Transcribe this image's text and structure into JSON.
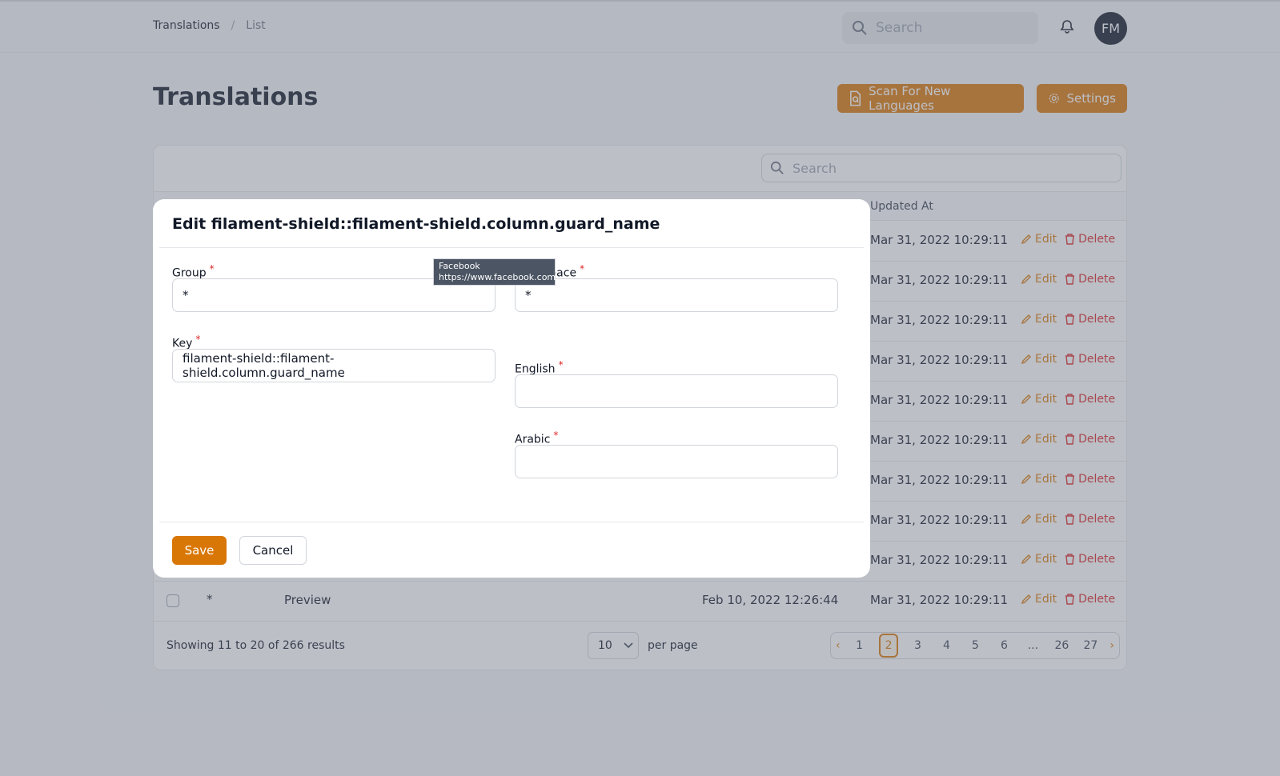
{
  "breadcrumb": {
    "root": "Translations",
    "current": "List"
  },
  "topbar": {
    "search_placeholder": "Search",
    "avatar_initials": "FM"
  },
  "page": {
    "title": "Translations"
  },
  "actions": {
    "scan_label": "Scan For New Languages",
    "settings_label": "Settings"
  },
  "table": {
    "search_placeholder": "Search",
    "header_updated_at": "Updated At",
    "rows": [
      {
        "updated_at": "Mar 31, 2022 10:29:11"
      },
      {
        "updated_at": "Mar 31, 2022 10:29:11"
      },
      {
        "updated_at": "Mar 31, 2022 10:29:11"
      },
      {
        "updated_at": "Mar 31, 2022 10:29:11"
      },
      {
        "updated_at": "Mar 31, 2022 10:29:11"
      },
      {
        "updated_at": "Mar 31, 2022 10:29:11"
      },
      {
        "updated_at": "Mar 31, 2022 10:29:11"
      },
      {
        "updated_at": "Mar 31, 2022 10:29:11"
      },
      {
        "updated_at": "Mar 31, 2022 10:29:11"
      }
    ],
    "last_row": {
      "group": "*",
      "key": "Preview",
      "created_at": "Feb 10, 2022 12:26:44",
      "updated_at": "Mar 31, 2022 10:29:11"
    },
    "edit_label": "Edit",
    "delete_label": "Delete"
  },
  "footer": {
    "showing": "Showing 11 to 20 of 266 results",
    "per_page_value": "10",
    "per_page_label": "per page",
    "pages": [
      "1",
      "2",
      "3",
      "4",
      "5",
      "6",
      "...",
      "26",
      "27"
    ],
    "current_page": "2"
  },
  "modal": {
    "title": "Edit filament-shield::filament-shield.column.guard_name",
    "group_label": "Group",
    "group_value": "*",
    "namespace_label_visible": "space",
    "namespace_value": "*",
    "key_label": "Key",
    "key_value": "filament-shield::filament-shield.column.guard_name",
    "english_label": "English",
    "english_value": "",
    "arabic_label": "Arabic",
    "arabic_value": "",
    "save_label": "Save",
    "cancel_label": "Cancel"
  },
  "tooltip": {
    "title": "Facebook",
    "url": "https://www.facebook.com"
  },
  "colors": {
    "accent": "#d97706",
    "danger": "#dc2626"
  }
}
